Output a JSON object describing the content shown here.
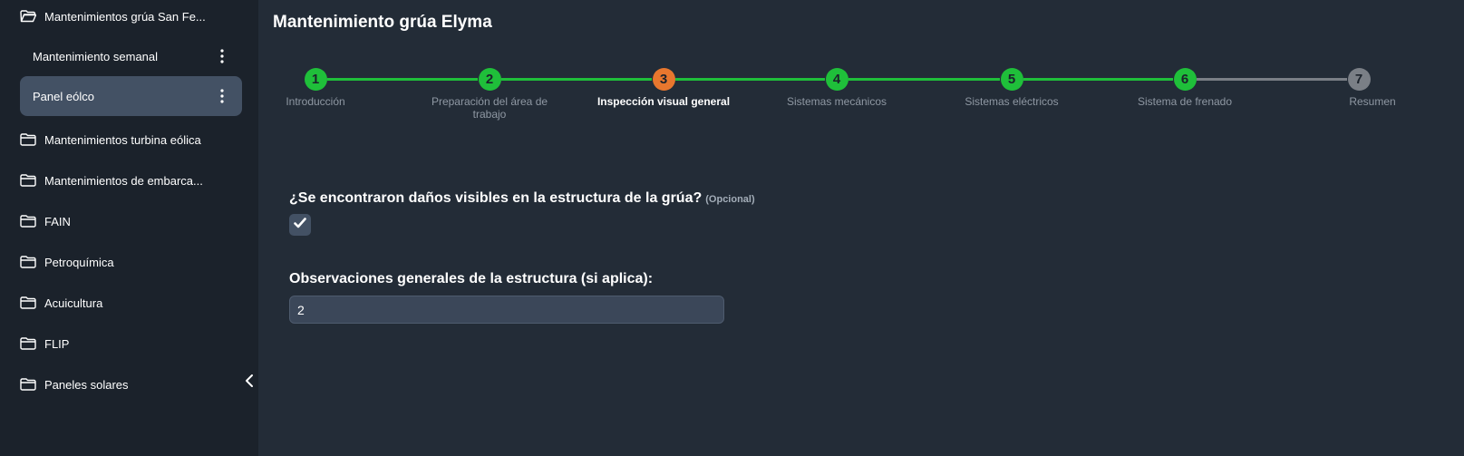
{
  "sidebar": {
    "folders_top": [
      {
        "label": "Mantenimientos grúa San Fe..."
      }
    ],
    "sub_items": [
      {
        "label": "Mantenimiento semanal"
      },
      {
        "label": "Panel eólco"
      }
    ],
    "folders": [
      {
        "label": "Mantenimientos turbina eólica"
      },
      {
        "label": "Mantenimientos de embarca..."
      },
      {
        "label": "FAIN"
      },
      {
        "label": "Petroquímica"
      },
      {
        "label": "Acuicultura"
      },
      {
        "label": "FLIP"
      },
      {
        "label": "Paneles solares"
      }
    ]
  },
  "main": {
    "title": "Mantenimiento grúa Elyma"
  },
  "stepper": {
    "colors": {
      "done": "#1fbf3a",
      "current": "#e8772e",
      "pending": "#7a7f86",
      "line_done": "#1fbf3a",
      "line_pending": "#7a7f86"
    },
    "steps": [
      {
        "number": "1",
        "label": "Introducción",
        "status": "done"
      },
      {
        "number": "2",
        "label": "Preparación del área de trabajo",
        "status": "done"
      },
      {
        "number": "3",
        "label": "Inspección visual general",
        "status": "current"
      },
      {
        "number": "4",
        "label": "Sistemas mecánicos",
        "status": "done"
      },
      {
        "number": "5",
        "label": "Sistemas eléctricos",
        "status": "done"
      },
      {
        "number": "6",
        "label": "Sistema de frenado",
        "status": "done"
      },
      {
        "number": "7",
        "label": "Resumen",
        "status": "pending"
      }
    ]
  },
  "form": {
    "question1": "¿Se encontraron daños visibles en la estructura de la grúa?",
    "question1_optional": "(Opcional)",
    "question1_checked": true,
    "question2": "Observaciones generales de la estructura (si aplica):",
    "question2_value": "2"
  }
}
